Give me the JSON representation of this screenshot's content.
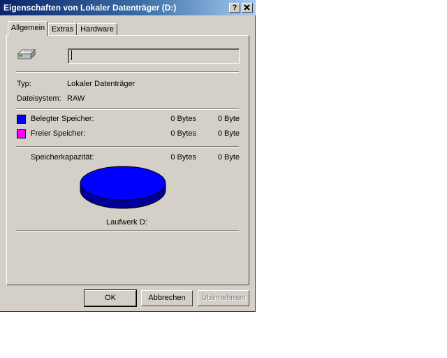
{
  "window": {
    "title": "Eigenschaften von Lokaler Datenträger (D:)",
    "help_label": "?",
    "close_label": "✕"
  },
  "tabs": [
    {
      "label": "Allgemein",
      "active": true
    },
    {
      "label": "Extras"
    },
    {
      "label": "Hardware"
    }
  ],
  "general": {
    "drive_name_value": "",
    "type_label": "Typ:",
    "type_value": "Lokaler Datenträger",
    "fs_label": "Dateisystem:",
    "fs_value": "RAW",
    "used_label": "Belegter Speicher:",
    "used_bytes": "0 Bytes",
    "used_size": "0 Byte",
    "free_label": "Freier Speicher:",
    "free_bytes": "0 Bytes",
    "free_size": "0 Byte",
    "capacity_label": "Speicherkapazität:",
    "capacity_bytes": "0 Bytes",
    "capacity_size": "0 Byte",
    "drive_label": "Laufwerk D:"
  },
  "colors": {
    "used": "#0000ff",
    "free": "#ff00ff",
    "pie_side": "#000099"
  },
  "icons": {
    "drive": "hard-drive-icon"
  },
  "buttons": {
    "ok": "OK",
    "cancel": "Abbrechen",
    "apply": "Übernehmen"
  }
}
